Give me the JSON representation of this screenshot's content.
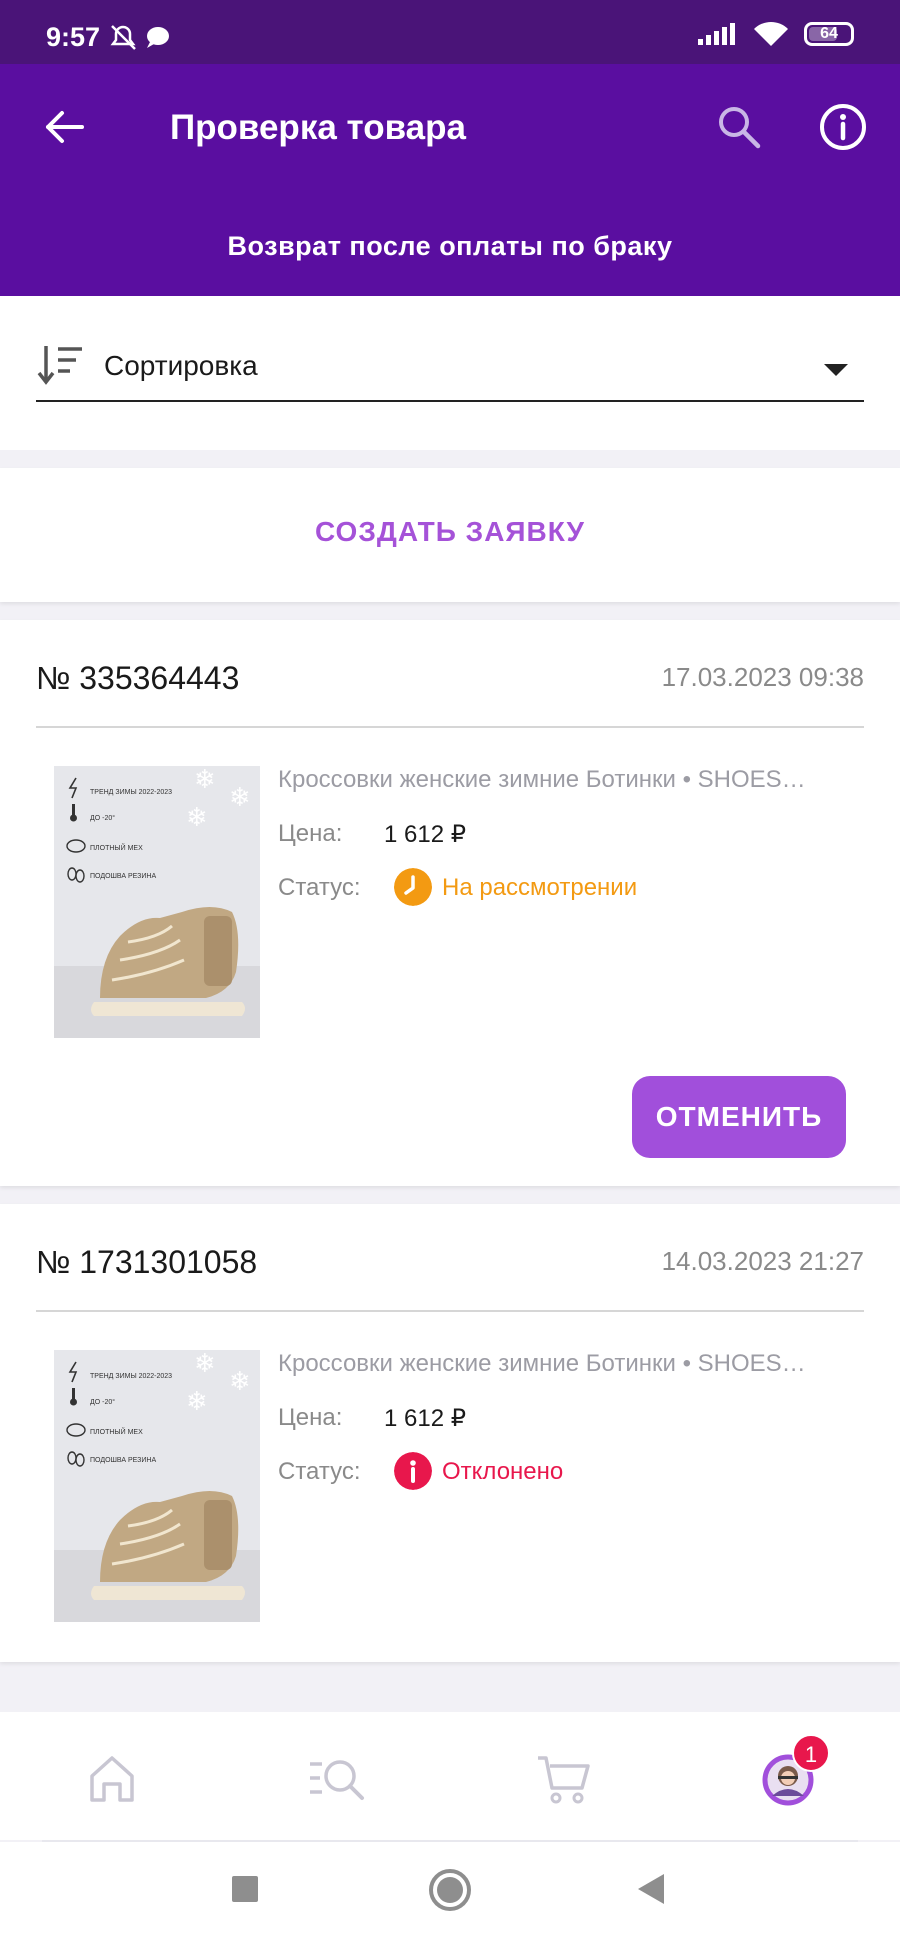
{
  "status_bar": {
    "time": "9:57",
    "battery": "64"
  },
  "appbar": {
    "title": "Проверка товара",
    "subtitle": "Возврат после оплаты по браку"
  },
  "sort": {
    "label": "Сортировка"
  },
  "create_button": "СОЗДАТЬ ЗАЯВКУ",
  "orders": [
    {
      "number": "№ 335364443",
      "date": "17.03.2023 09:38",
      "product_name": "Кроссовки женские зимние Ботинки • SHOES…",
      "price_label": "Цена:",
      "price": "1 612 ₽",
      "status_label": "Статус:",
      "status": "На рассмотрении",
      "status_color": "#f39a12",
      "cancel_label": "ОТМЕНИТЬ",
      "image_text": [
        "ТРЕНД ЗИМЫ 2022-2023",
        "ДО -20°",
        "ПЛОТНЫЙ МЕХ",
        "ПОДОШВА РЕЗИНА"
      ]
    },
    {
      "number": "№ 1731301058",
      "date": "14.03.2023 21:27",
      "product_name": "Кроссовки женские зимние Ботинки • SHOES…",
      "price_label": "Цена:",
      "price": "1 612 ₽",
      "status_label": "Статус:",
      "status": "Отклонено",
      "status_color": "#e8174c",
      "image_text": [
        "ТРЕНД ЗИМЫ 2022-2023",
        "ДО -20°",
        "ПЛОТНЫЙ МЕХ",
        "ПОДОШВА РЕЗИНА"
      ]
    }
  ],
  "bottom_nav": {
    "items": [
      "home-icon",
      "catalog-search-icon",
      "cart-icon",
      "profile-avatar"
    ],
    "badge": "1"
  },
  "colors": {
    "header": "#5a0ea0",
    "statusbar": "#4a1478",
    "accent": "#a14fdb"
  }
}
